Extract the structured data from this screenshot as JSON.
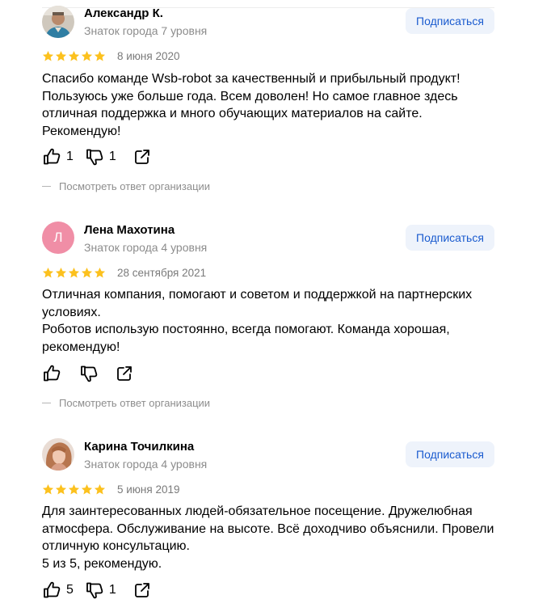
{
  "colors": {
    "star": "#fcc11e",
    "subscribe_text": "#1a5bcf",
    "subscribe_bg": "#eef3fb",
    "muted": "#8c8c8c",
    "avatar_letter_bg": "#f08ea6"
  },
  "icons": {
    "like": "thumb-up-icon",
    "dislike": "thumb-down-icon",
    "share": "share-icon",
    "star": "star-icon"
  },
  "reviews": [
    {
      "author": "Александр К.",
      "level": "Знаток города 7 уровня",
      "subscribe": "Подписаться",
      "rating": 5,
      "date": "8 июня 2020",
      "text": "Спасибо команде Wsb-robot за качественный и прибыльный продукт!\nПользуюсь уже больше года. Всем доволен! Но самое главное здесь\nотличная поддержка и много обучающих материалов на сайте.\nРекомендую!",
      "likes": "1",
      "dislikes": "1",
      "org_reply": "Посмотреть ответ организации"
    },
    {
      "author": "Лена Махотина",
      "level": "Знаток города 4 уровня",
      "avatar_letter": "Л",
      "subscribe": "Подписаться",
      "rating": 5,
      "date": "28 сентября 2021",
      "text": "Отличная компания, помогают и советом и поддержкой на партнерских\nусловиях.\nРоботов использую постоянно, всегда помогают. Команда хорошая,\nрекомендую!",
      "likes": "",
      "dislikes": "",
      "org_reply": "Посмотреть ответ организации"
    },
    {
      "author": "Карина Точилкина",
      "level": "Знаток города 4 уровня",
      "subscribe": "Подписаться",
      "rating": 5,
      "date": "5 июня 2019",
      "text": "Для заинтересованных людей-обязательное посещение. Дружелюбная\nатмосфера. Обслуживание на высоте. Всё доходчиво объяснили. Провели\nотличную консультацию.\n5 из 5, рекомендую.",
      "likes": "5",
      "dislikes": "1"
    }
  ]
}
